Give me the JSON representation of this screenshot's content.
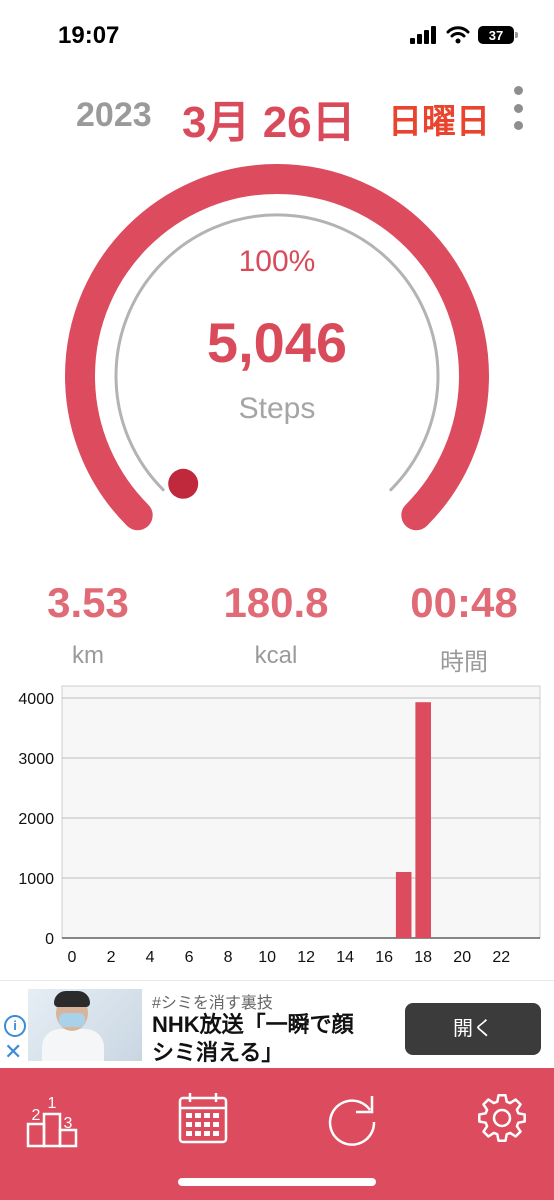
{
  "status_bar": {
    "time": "19:07",
    "battery": "37"
  },
  "date": {
    "year": "2023",
    "month_day": "3月 26日",
    "weekday": "日曜日"
  },
  "progress": {
    "percent_text": "100%",
    "steps": "5,046",
    "unit": "Steps",
    "fraction": 1.0
  },
  "stats": [
    {
      "value": "3.53",
      "label": "km"
    },
    {
      "value": "180.8",
      "label": "kcal"
    },
    {
      "value": "00:48",
      "label": "時間"
    }
  ],
  "chart_data": {
    "type": "bar",
    "x": [
      0,
      1,
      2,
      3,
      4,
      5,
      6,
      7,
      8,
      9,
      10,
      11,
      12,
      13,
      14,
      15,
      16,
      17,
      18,
      19,
      20,
      21,
      22,
      23
    ],
    "values": [
      0,
      0,
      0,
      0,
      0,
      0,
      0,
      0,
      0,
      0,
      0,
      0,
      0,
      0,
      0,
      0,
      0,
      1100,
      3930,
      0,
      0,
      0,
      0,
      0
    ],
    "xticks": [
      "0",
      "2",
      "4",
      "6",
      "8",
      "10",
      "12",
      "14",
      "16",
      "18",
      "20",
      "22"
    ],
    "yticks": [
      "0",
      "1000",
      "2000",
      "3000",
      "4000"
    ],
    "ylim": [
      0,
      4200
    ],
    "grid": true,
    "bar_color": "#dc4c5e"
  },
  "ad": {
    "tag": "#シミを消す裏技",
    "headline_line1": "NHK放送「一瞬で顔",
    "headline_line2": "シミ消える」",
    "button": "開く"
  },
  "tabbar": {
    "items": [
      {
        "icon": "ranking-podium-icon"
      },
      {
        "icon": "calendar-icon"
      },
      {
        "icon": "refresh-icon"
      },
      {
        "icon": "gear-icon"
      }
    ]
  },
  "colors": {
    "accent": "#dc4c5e",
    "accent_light": "#e06a76",
    "weekday": "#e8442e",
    "muted": "#9a9a9a"
  }
}
